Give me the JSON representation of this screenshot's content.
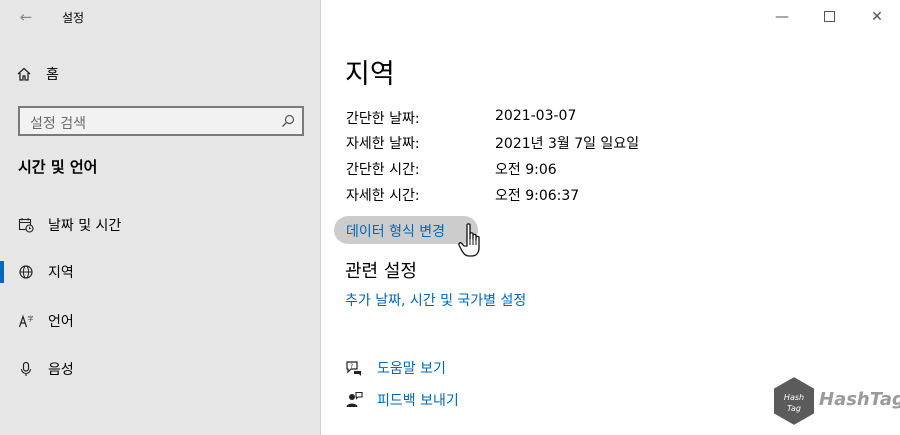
{
  "window": {
    "app_title": "설정"
  },
  "sidebar": {
    "home_label": "홈",
    "search_placeholder": "설정 검색",
    "section_title": "시간 및 언어",
    "items": [
      {
        "label": "날짜 및 시간",
        "icon": "calendar-clock-icon",
        "selected": false
      },
      {
        "label": "지역",
        "icon": "globe-icon",
        "selected": true
      },
      {
        "label": "언어",
        "icon": "language-icon",
        "selected": false
      },
      {
        "label": "음성",
        "icon": "microphone-icon",
        "selected": false
      }
    ]
  },
  "main": {
    "title": "지역",
    "formats": [
      {
        "label": "간단한 날짜:",
        "value": "2021-03-07"
      },
      {
        "label": "자세한 날짜:",
        "value": "2021년 3월 7일 일요일"
      },
      {
        "label": "간단한 시간:",
        "value": "오전 9:06"
      },
      {
        "label": "자세한 시간:",
        "value": "오전 9:06:37"
      }
    ],
    "change_button_label": "데이터 형식 변경",
    "related_title": "관련 설정",
    "related_link": "추가 날짜, 시간 및 국가별 설정",
    "help_label": "도움말 보기",
    "feedback_label": "피드백 보내기"
  },
  "watermark": {
    "text": "HashTag",
    "badge_text": "Hash Tag"
  },
  "colors": {
    "accent": "#0067c0",
    "link": "#0067b8",
    "sidebar_bg": "#e6e6e6"
  }
}
